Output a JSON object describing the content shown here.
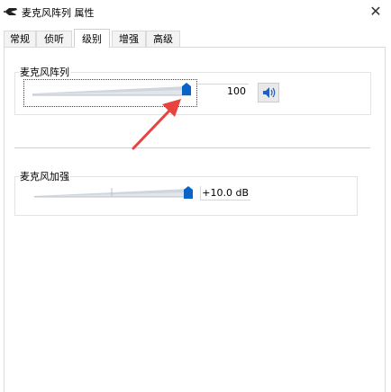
{
  "window": {
    "title": "麦克风阵列 属性",
    "close_label": "✕"
  },
  "tabs": [
    {
      "label": "常规",
      "active": false
    },
    {
      "label": "侦听",
      "active": false
    },
    {
      "label": "级别",
      "active": true
    },
    {
      "label": "增强",
      "active": false
    },
    {
      "label": "高级",
      "active": false
    }
  ],
  "levels": {
    "mic_array": {
      "label": "麦克风阵列",
      "value_text": "100",
      "level": 1.0
    },
    "mic_boost": {
      "label": "麦克风加强",
      "value_text": "+10.0 dB",
      "level": 1.0
    }
  },
  "colors": {
    "accent": "#0a64c8",
    "arrow": "#e8433f"
  },
  "icons": {
    "app": "microphone-icon",
    "speaker": "speaker-icon"
  }
}
